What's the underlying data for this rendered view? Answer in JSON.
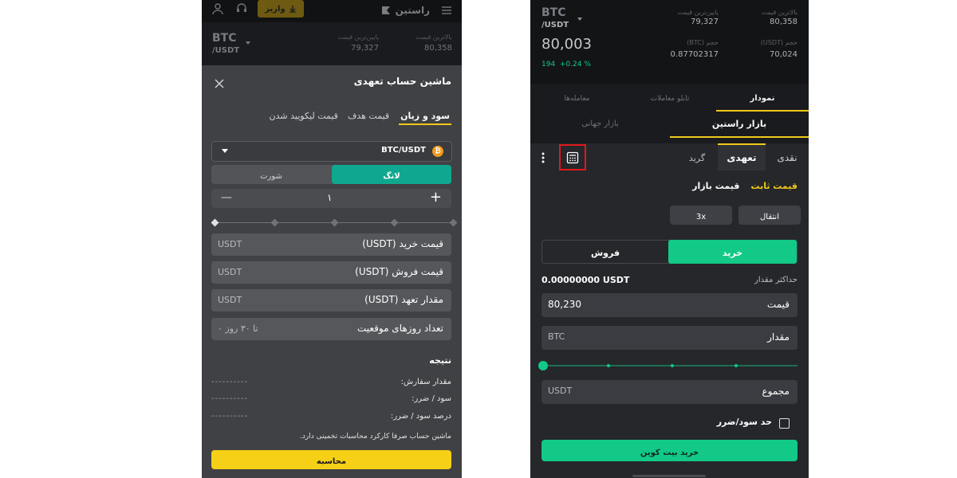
{
  "left": {
    "header": {
      "deposit_label": "واریز",
      "logo_text": "راستین"
    },
    "ticker": {
      "pair_base": "BTC",
      "pair_quote": "/USDT",
      "high_label": "بالاترین قیمت",
      "high_value": "80,358",
      "low_label": "پایین‌ترین قیمت",
      "low_value": "79,327"
    },
    "modal": {
      "title": "ماشین حساب تعهدی",
      "tabs": [
        "سود و زیان",
        "قیمت هدف",
        "قیمت لیکویید شدن"
      ],
      "pair": "BTC/USDT",
      "long_label": "لانگ",
      "short_label": "شورت",
      "leverage_value": "۱",
      "fields": [
        {
          "label": "قیمت خرید (USDT)",
          "unit": "USDT"
        },
        {
          "label": "قیمت فروش (USDT)",
          "unit": "USDT"
        },
        {
          "label": "مقدار تعهد (USDT)",
          "unit": "USDT"
        },
        {
          "label": "تعداد روزهای موقعیت",
          "unit": "تا ۳۰ روز ۰"
        }
      ],
      "result_title": "نتیجه",
      "results": [
        {
          "label": "مقدار سفارش:",
          "value": "----------"
        },
        {
          "label": "سود / ضرر:",
          "value": "----------"
        },
        {
          "label": "درصد سود / ضرر:",
          "value": "----------"
        }
      ],
      "note": "ماشین حساب صرفا کارکرد محاسبات تخمینی دارد.",
      "calc_button": "محاسبه"
    }
  },
  "right": {
    "ticker": {
      "pair_base": "BTC",
      "pair_quote": "/USDT",
      "price": "80,003",
      "change_abs": "194",
      "change_pct": "+0.24 %",
      "high_label": "بالاترین قیمت",
      "high_value": "80,358",
      "low_label": "پایین‌ترین قیمت",
      "low_value": "79,327",
      "vol_usdt_label": "حجم (USDT)",
      "vol_usdt_value": "70,024",
      "vol_btc_label": "حجم (BTC)",
      "vol_btc_value": "0.87702317"
    },
    "tabs1": [
      "نمودار",
      "تابلو معاملات",
      "معامله‌ها"
    ],
    "tabs2": [
      "بازار راستین",
      "بازار جهانی"
    ],
    "trade_tabs": [
      "نقدی",
      "تعهدی",
      "گرید"
    ],
    "order_types": [
      "قیمت ثابت",
      "قیمت بازار"
    ],
    "transfer_label": "انتقال",
    "leverage_label": "3x",
    "buy_label": "خرید",
    "sell_label": "فروش",
    "max_label": "حداکثر مقدار",
    "max_value": "0.00000000 USDT",
    "price_label": "قیمت",
    "price_value": "80,230",
    "amount_label": "مقدار",
    "amount_unit": "BTC",
    "total_label": "مجموع",
    "total_unit": "USDT",
    "tpsl_label": "حد سود/ضرر",
    "submit_label": "خرید بیت کوین",
    "colors": {
      "accent_yellow": "#f0c91a",
      "buy_green": "#12c987",
      "long_teal": "#0fa88e",
      "highlight_red": "#e0191b"
    }
  }
}
